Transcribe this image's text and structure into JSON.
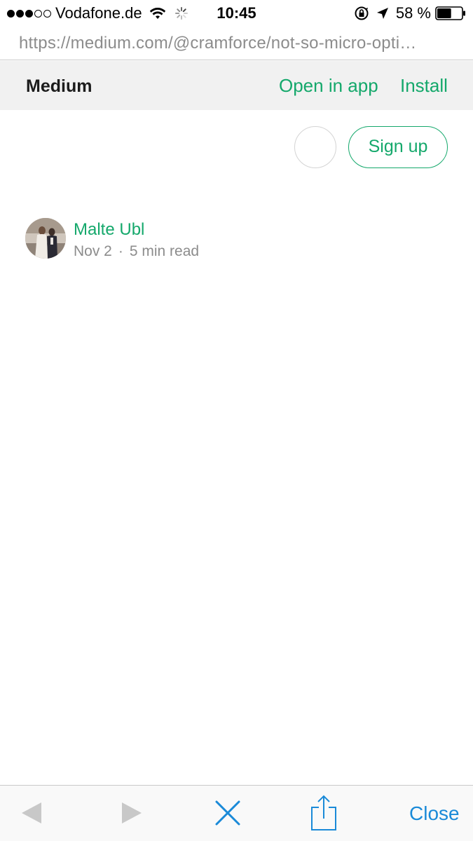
{
  "status_bar": {
    "carrier": "Vodafone.de",
    "time": "10:45",
    "battery_percent": "58 %",
    "signal_bars_filled": 3,
    "signal_bars_total": 5,
    "battery_level": 0.58
  },
  "browser": {
    "url": "https://medium.com/@cramforce/not-so-micro-opti…"
  },
  "app_banner": {
    "title": "Medium",
    "open_in_app": "Open in app",
    "install": "Install"
  },
  "header": {
    "signup_label": "Sign up"
  },
  "author": {
    "name": "Malte Ubl",
    "date": "Nov 2",
    "separator": "·",
    "read_time": "5 min read"
  },
  "toolbar": {
    "close_label": "Close"
  },
  "colors": {
    "accent_green": "#14a86b",
    "ios_blue": "#1a8ad8",
    "banner_bg": "#f1f1f1",
    "disabled_gray": "#c8c8c8"
  }
}
